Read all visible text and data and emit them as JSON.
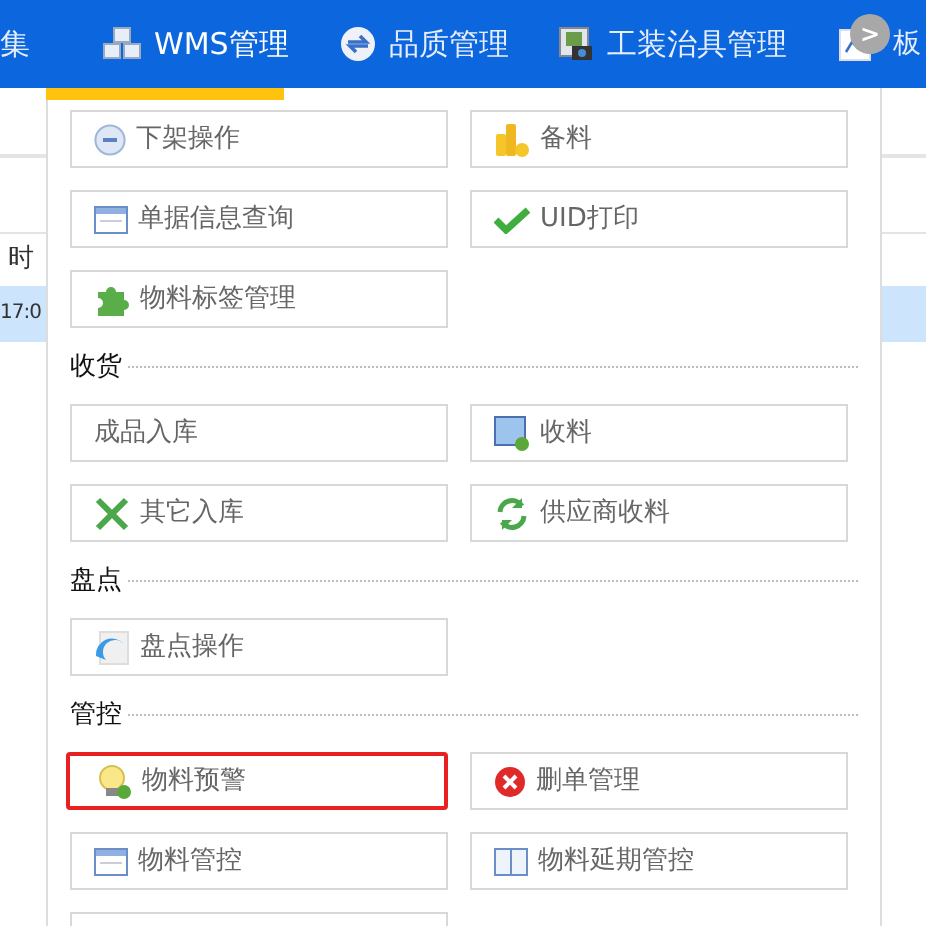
{
  "nav": [
    {
      "label": "集",
      "selected": false
    },
    {
      "label": "WMS管理",
      "selected": true
    },
    {
      "label": "品质管理",
      "selected": false
    },
    {
      "label": "工装治具管理",
      "selected": false
    },
    {
      "label": "板",
      "selected": false
    }
  ],
  "scroll_button": {
    "label": ">"
  },
  "background_table": {
    "header_cell": "时",
    "row_cell": "17:0"
  },
  "sections": [
    {
      "buttons": [
        {
          "label": "下架操作",
          "selected": false
        },
        {
          "label": "备料",
          "selected": false
        },
        {
          "label": "单据信息查询",
          "selected": false
        },
        {
          "label": "UID打印",
          "selected": false
        },
        {
          "label": "物料标签管理",
          "selected": false
        }
      ]
    },
    {
      "title": "收货",
      "buttons": [
        {
          "label": "成品入库",
          "selected": false
        },
        {
          "label": "收料",
          "selected": false
        },
        {
          "label": "其它入库",
          "selected": false
        },
        {
          "label": "供应商收料",
          "selected": false
        }
      ]
    },
    {
      "title": "盘点",
      "buttons": [
        {
          "label": "盘点操作",
          "selected": false
        }
      ]
    },
    {
      "title": "管控",
      "buttons": [
        {
          "label": "物料预警",
          "selected": true
        },
        {
          "label": "删单管理",
          "selected": false
        },
        {
          "label": "物料管控",
          "selected": false
        },
        {
          "label": "物料延期管控",
          "selected": false
        },
        {
          "selected": false
        }
      ]
    }
  ]
}
